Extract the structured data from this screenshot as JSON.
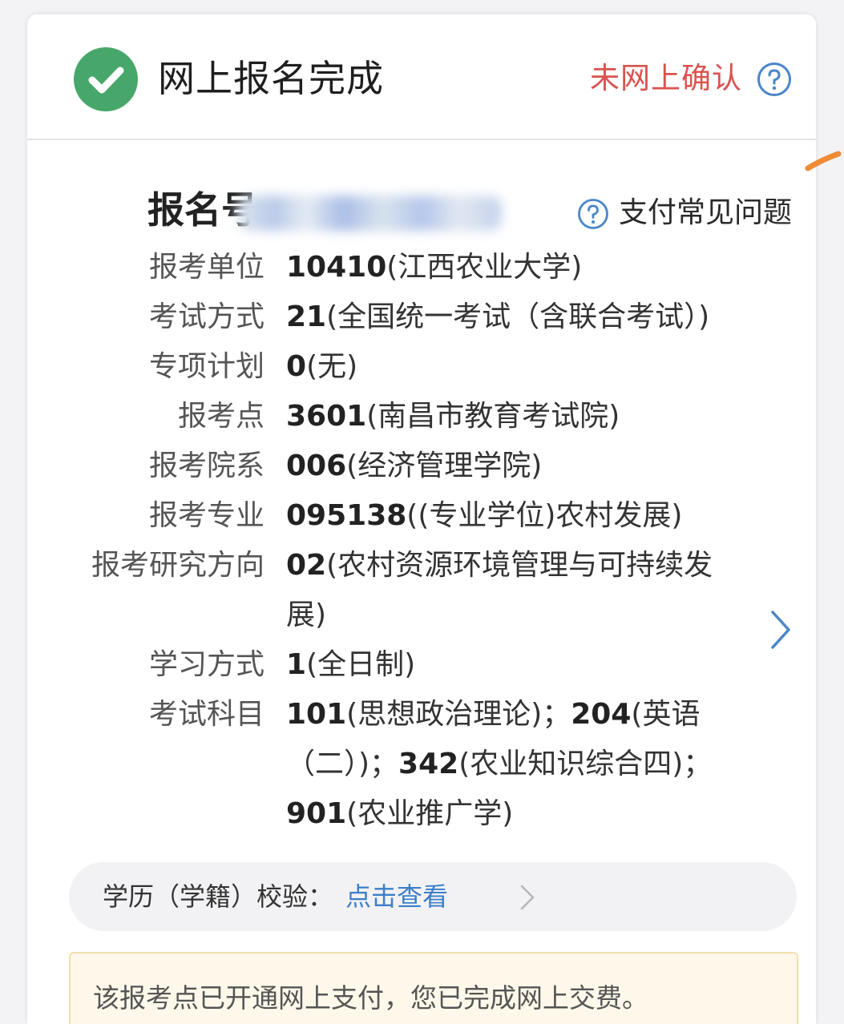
{
  "header": {
    "title": "网上报名完成",
    "confirm_status": "未网上确认",
    "status_color": "#d9534f",
    "check_color": "#47a76a"
  },
  "registration": {
    "label": "报名号",
    "pay_faq": "支付常见问题"
  },
  "details": [
    {
      "label": "报考单位",
      "code": "10410",
      "text": "(江西农业大学)"
    },
    {
      "label": "考试方式",
      "code": "21",
      "text": "(全国统一考试（含联合考试）)"
    },
    {
      "label": "专项计划",
      "code": "0",
      "text": "(无)"
    },
    {
      "label": "报考点",
      "code": "3601",
      "text": "(南昌市教育考试院)"
    },
    {
      "label": "报考院系",
      "code": "006",
      "text": "(经济管理学院)"
    },
    {
      "label": "报考专业",
      "code": "095138",
      "text": "((专业学位)农村发展)"
    },
    {
      "label": "报考研究方向",
      "code": "02",
      "text": "(农村资源环境管理与可持续发展)"
    },
    {
      "label": "学习方式",
      "code": "1",
      "text": "(全日制)"
    }
  ],
  "subjects": {
    "label": "考试科目",
    "items": [
      {
        "code": "101",
        "text": "(思想政治理论)；"
      },
      {
        "code": "204",
        "text": "(英语（二）)；"
      },
      {
        "code": "342",
        "text": "(农业知识综合四)；"
      },
      {
        "code": "901",
        "text": "(农业推广学)"
      }
    ]
  },
  "education_check": {
    "label": "学历（学籍）校验：",
    "link": "点击查看",
    "link_color": "#3d7ec9"
  },
  "notice": {
    "text": "该报考点已开通网上支付，您已完成网上交费。"
  }
}
